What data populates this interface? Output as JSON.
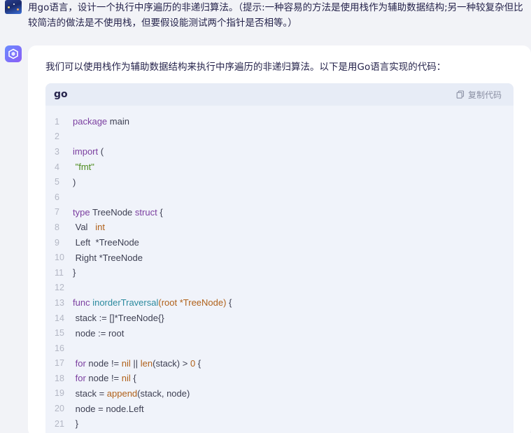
{
  "user": {
    "message": "用go语言，设计一个执行中序遍历的非递归算法。（提示:一种容易的方法是使用栈作为辅助数据结构;另一种较复杂但比较简洁的做法是不使用栈，但要假设能测试两个指针是否相等。）"
  },
  "answer": {
    "intro": "我们可以使用栈作为辅助数据结构来执行中序遍历的非递归算法。以下是用Go语言实现的代码：",
    "code_block": {
      "language": "go",
      "copy_label": "复制代码",
      "lines": [
        {
          "n": "1",
          "tokens": [
            [
              "kw",
              "package"
            ],
            [
              "code",
              " main"
            ]
          ]
        },
        {
          "n": "2",
          "tokens": []
        },
        {
          "n": "3",
          "tokens": [
            [
              "kw",
              "import"
            ],
            [
              "code",
              " ("
            ]
          ]
        },
        {
          "n": "4",
          "tokens": [
            [
              "code",
              " "
            ],
            [
              "str",
              "\"fmt\""
            ]
          ]
        },
        {
          "n": "5",
          "tokens": [
            [
              "code",
              ")"
            ]
          ]
        },
        {
          "n": "6",
          "tokens": []
        },
        {
          "n": "7",
          "tokens": [
            [
              "kw",
              "type"
            ],
            [
              "code",
              " TreeNode "
            ],
            [
              "kw",
              "struct"
            ],
            [
              "code",
              " {"
            ]
          ]
        },
        {
          "n": "8",
          "tokens": [
            [
              "code",
              " Val   "
            ],
            [
              "typ",
              "int"
            ]
          ]
        },
        {
          "n": "9",
          "tokens": [
            [
              "code",
              " Left  *TreeNode"
            ]
          ]
        },
        {
          "n": "10",
          "tokens": [
            [
              "code",
              " Right *TreeNode"
            ]
          ]
        },
        {
          "n": "11",
          "tokens": [
            [
              "code",
              "}"
            ]
          ]
        },
        {
          "n": "12",
          "tokens": []
        },
        {
          "n": "13",
          "tokens": [
            [
              "kw",
              "func"
            ],
            [
              "code",
              " "
            ],
            [
              "fn",
              "inorderTraversal"
            ],
            [
              "typ",
              "(root *TreeNode)"
            ],
            [
              "code",
              " {"
            ]
          ]
        },
        {
          "n": "14",
          "tokens": [
            [
              "code",
              " stack := []*TreeNode{}"
            ]
          ]
        },
        {
          "n": "15",
          "tokens": [
            [
              "code",
              " node := root"
            ]
          ]
        },
        {
          "n": "16",
          "tokens": []
        },
        {
          "n": "17",
          "tokens": [
            [
              "code",
              " "
            ],
            [
              "kw",
              "for"
            ],
            [
              "code",
              " node != "
            ],
            [
              "bi",
              "nil"
            ],
            [
              "code",
              " || "
            ],
            [
              "bi",
              "len"
            ],
            [
              "code",
              "(stack) > "
            ],
            [
              "num",
              "0"
            ],
            [
              "code",
              " {"
            ]
          ]
        },
        {
          "n": "18",
          "tokens": [
            [
              "code",
              " "
            ],
            [
              "kw",
              "for"
            ],
            [
              "code",
              " node != "
            ],
            [
              "bi",
              "nil"
            ],
            [
              "code",
              " {"
            ]
          ]
        },
        {
          "n": "19",
          "tokens": [
            [
              "code",
              " stack = "
            ],
            [
              "bi",
              "append"
            ],
            [
              "code",
              "(stack, node)"
            ]
          ]
        },
        {
          "n": "20",
          "tokens": [
            [
              "code",
              " node = node.Left"
            ]
          ]
        },
        {
          "n": "21",
          "tokens": [
            [
              "code",
              " }"
            ]
          ]
        }
      ]
    }
  },
  "colors": {
    "background": "#f2f3f7",
    "card": "#ffffff",
    "code_bg": "#f0f3fa",
    "keyword": "#7b3fa0",
    "function": "#2b8a9e",
    "type": "#b0611a",
    "string": "#4d8b1e"
  },
  "icons": {
    "user_avatar": "user-avatar-image",
    "ai_avatar": "cube-logo-icon",
    "copy": "copy-icon"
  }
}
